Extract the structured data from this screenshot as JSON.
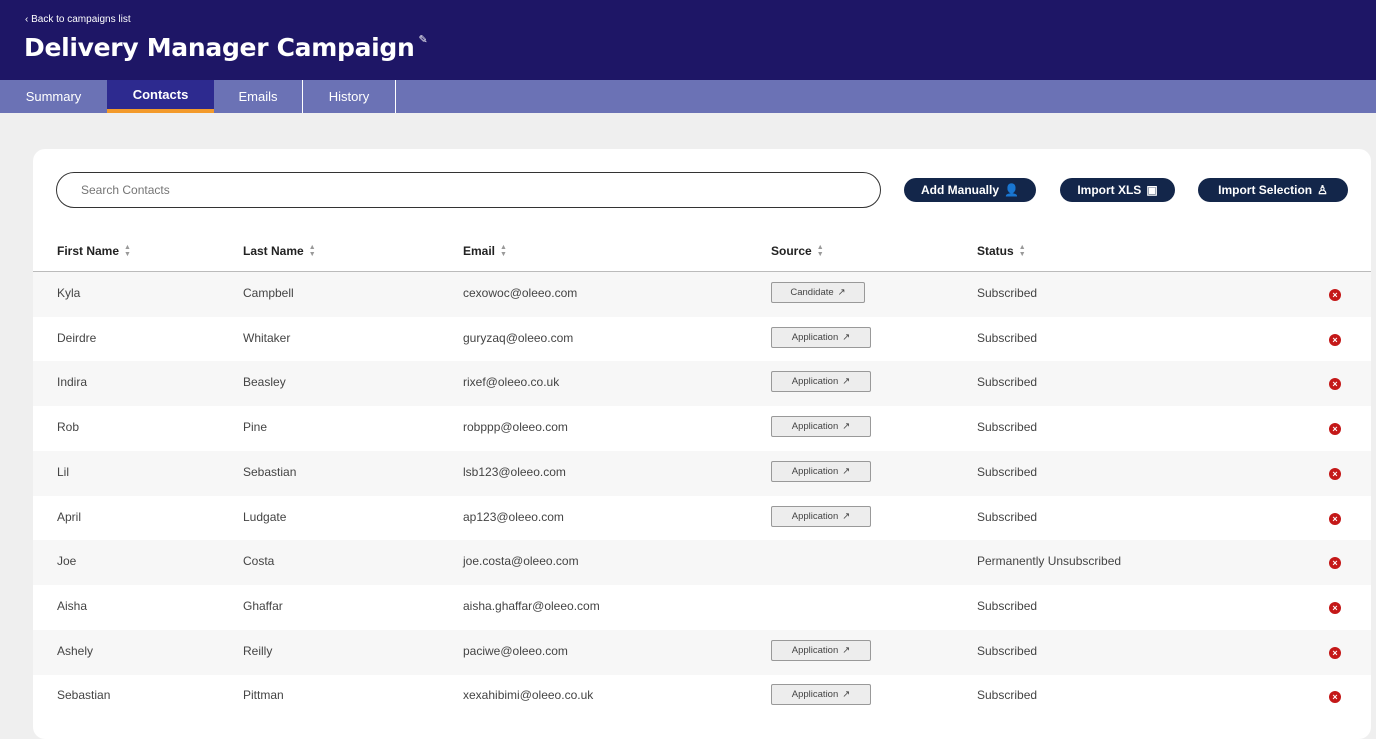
{
  "header": {
    "back": "‹ Back to campaigns list",
    "title": "Delivery Manager Campaign"
  },
  "tabs": [
    "Summary",
    "Contacts",
    "Emails",
    "History"
  ],
  "search": {
    "placeholder": "Search Contacts"
  },
  "buttons": {
    "add": "Add Manually",
    "xls": "Import XLS",
    "selection": "Import Selection"
  },
  "columns": [
    "First Name",
    "Last Name",
    "Email",
    "Source",
    "Status"
  ],
  "rows": [
    {
      "first": "Kyla",
      "last": "Campbell",
      "email": "cexowoc@oleeo.com",
      "source": "Candidate",
      "status": "Subscribed"
    },
    {
      "first": "Deirdre",
      "last": "Whitaker",
      "email": "guryzaq@oleeo.com",
      "source": "Application",
      "status": "Subscribed"
    },
    {
      "first": "Indira",
      "last": "Beasley",
      "email": "rixef@oleeo.co.uk",
      "source": "Application",
      "status": "Subscribed"
    },
    {
      "first": "Rob",
      "last": "Pine",
      "email": "robppp@oleeo.com",
      "source": "Application",
      "status": "Subscribed"
    },
    {
      "first": "Lil",
      "last": "Sebastian",
      "email": "lsb123@oleeo.com",
      "source": "Application",
      "status": "Subscribed"
    },
    {
      "first": "April",
      "last": "Ludgate",
      "email": "ap123@oleeo.com",
      "source": "Application",
      "status": "Subscribed"
    },
    {
      "first": "Joe",
      "last": "Costa",
      "email": "joe.costa@oleeo.com",
      "source": "",
      "status": "Permanently Unsubscribed"
    },
    {
      "first": "Aisha",
      "last": "Ghaffar",
      "email": "aisha.ghaffar@oleeo.com",
      "source": "",
      "status": "Subscribed"
    },
    {
      "first": "Ashely",
      "last": "Reilly",
      "email": "paciwe@oleeo.com",
      "source": "Application",
      "status": "Subscribed"
    },
    {
      "first": "Sebastian",
      "last": "Pittman",
      "email": "xexahibimi@oleeo.co.uk",
      "source": "Application",
      "status": "Subscribed"
    }
  ]
}
